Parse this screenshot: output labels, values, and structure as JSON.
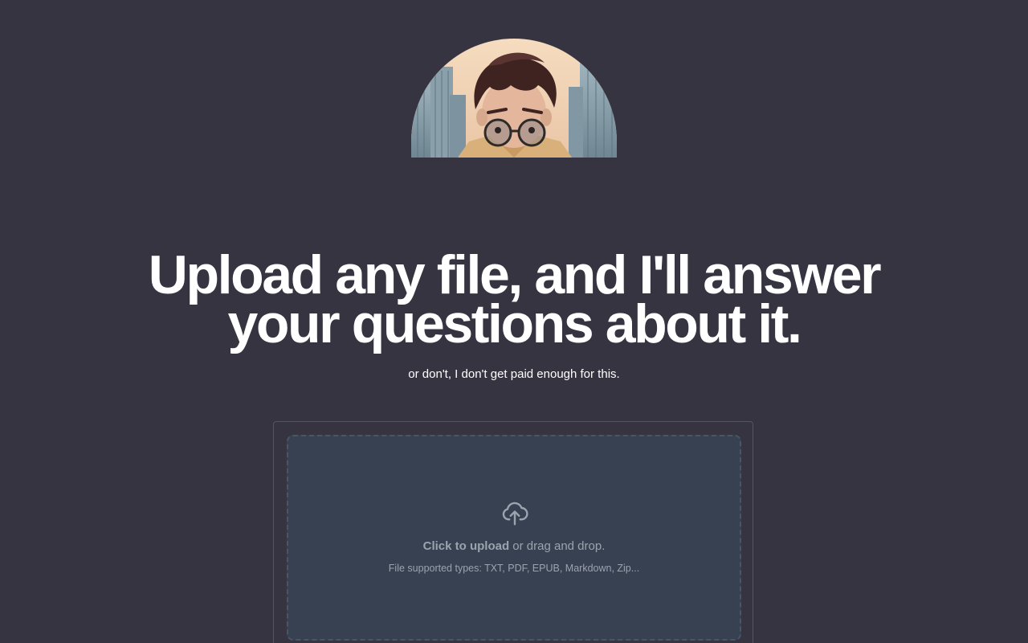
{
  "avatar": {
    "alt": "Illustrated avatar of a man with glasses in front of city buildings"
  },
  "hero": {
    "title": "Upload any file, and I'll answer your questions about it.",
    "subtitle": "or don't, I don't get paid enough for this."
  },
  "upload": {
    "icon": "cloud-upload-icon",
    "click_label": "Click to upload",
    "drag_text": " or drag and drop.",
    "supported_types": "File supported types: TXT, PDF, EPUB, Markdown, Zip..."
  },
  "colors": {
    "background": "#353440",
    "dropzone": "#374151",
    "muted_text": "#9ca3af",
    "title": "#ffffff"
  }
}
